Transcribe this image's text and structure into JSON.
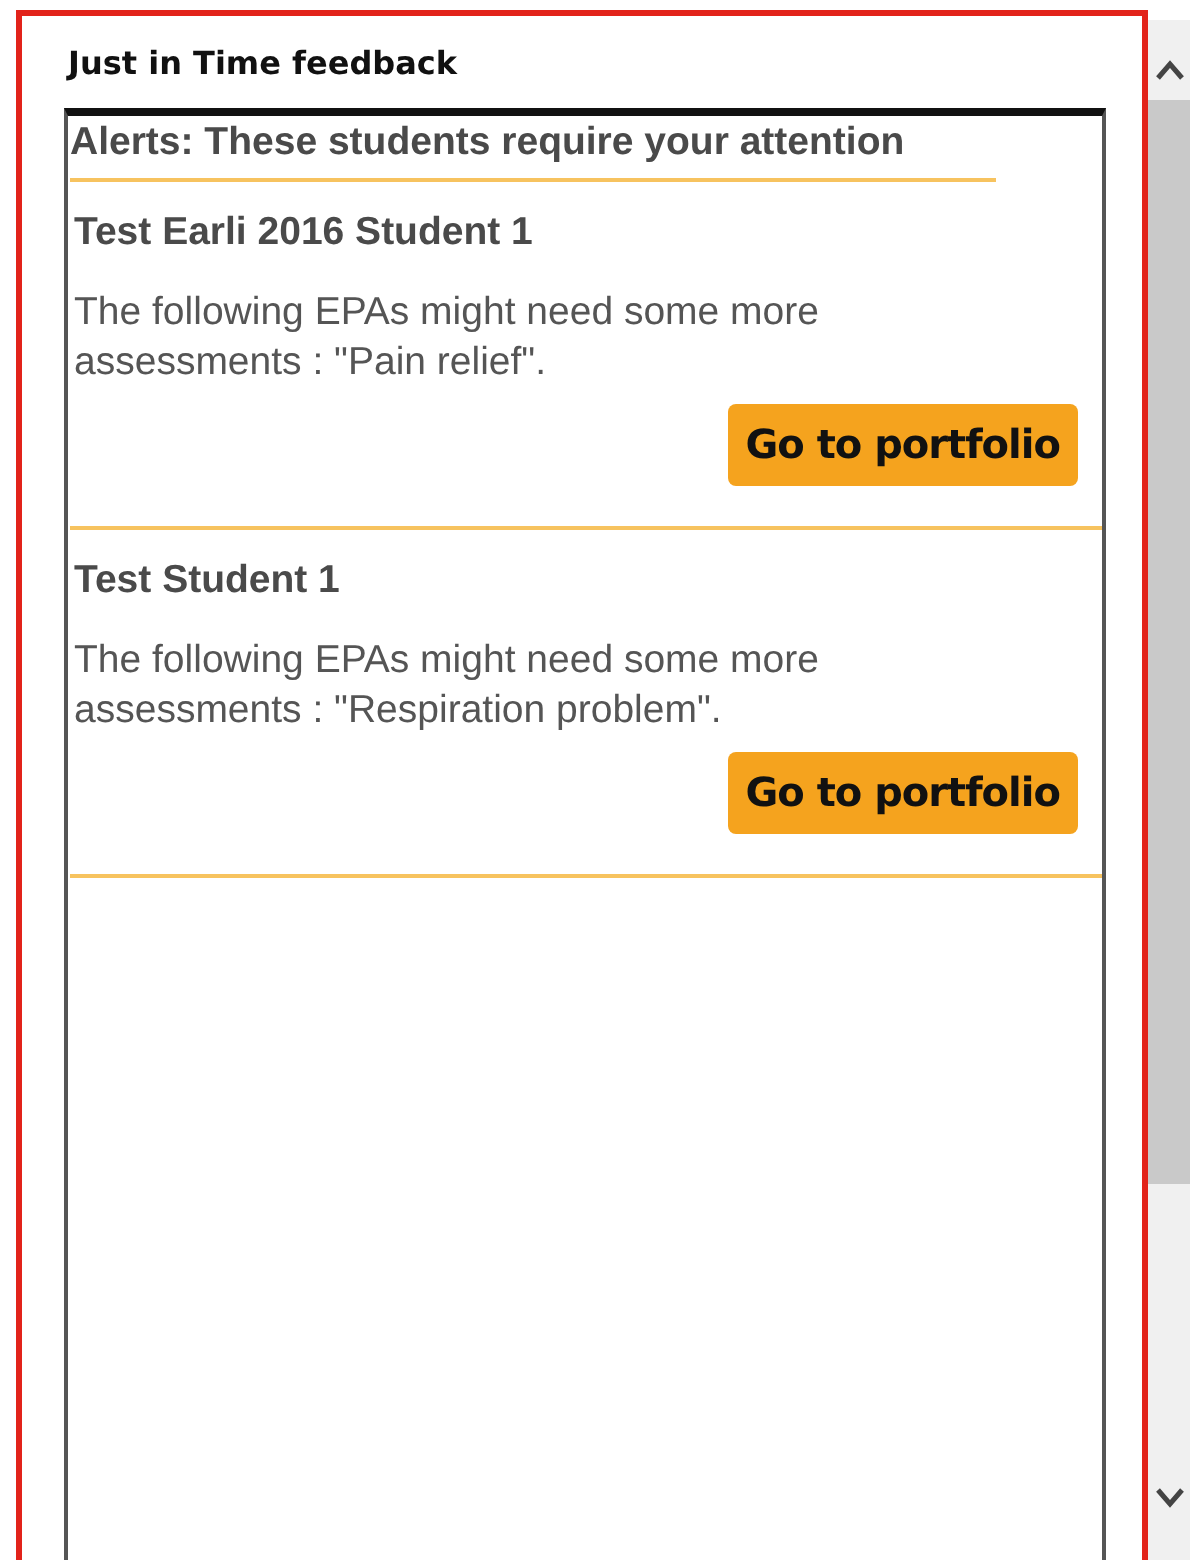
{
  "panel": {
    "title": "Just in Time feedback"
  },
  "alerts": {
    "heading": "Alerts: These students require your attention",
    "items": [
      {
        "student": "Test Earli 2016 Student 1",
        "message": "The following EPAs might need some more assessments : \"Pain relief\".",
        "button": "Go to portfolio"
      },
      {
        "student": "Test Student 1",
        "message": "The following EPAs might need some more assessments : \"Respiration problem\".",
        "button": "Go to portfolio"
      }
    ]
  }
}
